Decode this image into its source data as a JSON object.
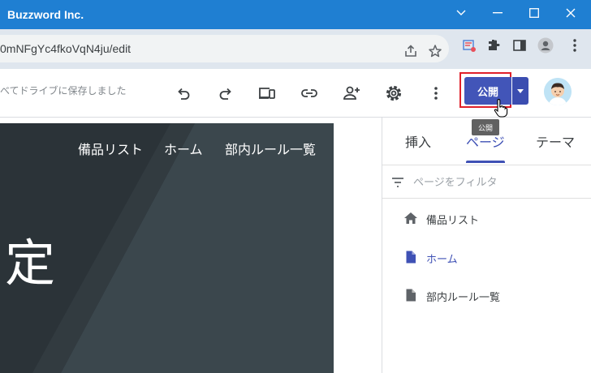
{
  "window": {
    "title": "Buzzword Inc."
  },
  "address_bar": {
    "url": "0mNFgYc4fkoVqN4ju/edit"
  },
  "toolbar": {
    "saved_status": "べてドライブに保存しました",
    "publish_label": "公開",
    "publish_tooltip": "公開"
  },
  "site_preview": {
    "nav": [
      "備品リスト",
      "ホーム",
      "部内ルール一覧"
    ],
    "hero_text": "定"
  },
  "panel": {
    "tabs": [
      "挿入",
      "ページ",
      "テーマ"
    ],
    "active_tab": "ページ",
    "filter_placeholder": "ページをフィルタ",
    "pages": [
      {
        "label": "備品リスト",
        "icon": "home-icon"
      },
      {
        "label": "ホーム",
        "icon": "page-icon",
        "active": true
      },
      {
        "label": "部内ルール一覧",
        "icon": "page-icon"
      }
    ]
  },
  "colors": {
    "titlebar": "#1f7fd2",
    "publish_button": "#4255b8",
    "accent": "#3f51b5",
    "highlight_box": "#e0202a"
  }
}
